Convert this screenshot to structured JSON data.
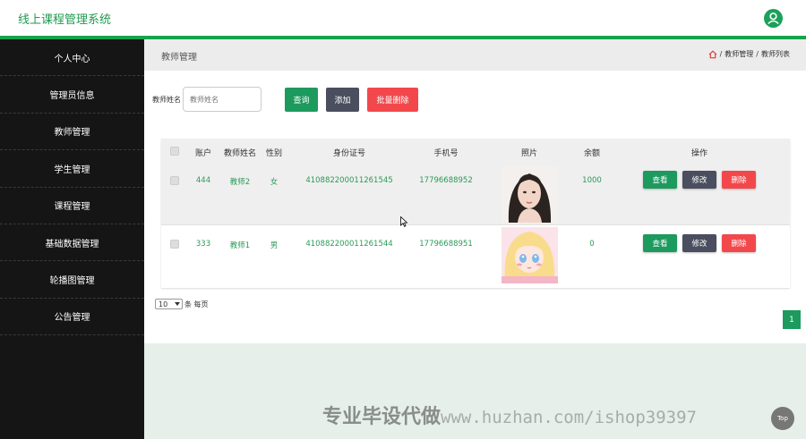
{
  "app": {
    "title": "线上课程管理系统"
  },
  "sidebar": {
    "items": [
      {
        "label": "个人中心"
      },
      {
        "label": "管理员信息"
      },
      {
        "label": "教师管理"
      },
      {
        "label": "学生管理"
      },
      {
        "label": "课程管理"
      },
      {
        "label": "基础数据管理"
      },
      {
        "label": "轮播图管理"
      },
      {
        "label": "公告管理"
      }
    ]
  },
  "header": {
    "page_title": "教师管理",
    "breadcrumb": [
      "教师管理",
      "教师列表"
    ],
    "home_icon": "home-icon"
  },
  "search": {
    "label": "教师姓名",
    "placeholder": "教师姓名",
    "query_label": "查询",
    "add_label": "添加",
    "batch_delete_label": "批量删除"
  },
  "table": {
    "columns": [
      "账户",
      "教师姓名",
      "性别",
      "身份证号",
      "手机号",
      "照片",
      "余额",
      "操作"
    ],
    "rows": [
      {
        "account": "444",
        "name": "教师2",
        "gender": "女",
        "id_card": "410882200011261545",
        "phone": "17796688952",
        "balance": "1000"
      },
      {
        "account": "333",
        "name": "教师1",
        "gender": "男",
        "id_card": "410882200011261544",
        "phone": "17796688951",
        "balance": "0"
      }
    ],
    "actions": {
      "view": "查看",
      "edit": "修改",
      "delete": "删除"
    }
  },
  "pager": {
    "page_size": "10",
    "per_page_label": "条 每页",
    "current_page": "1"
  },
  "watermark": {
    "text": "专业毕设代做",
    "url": "www.huzhan.com/ishop39397"
  },
  "back_to_top": {
    "label": "Top"
  },
  "colors": {
    "accent": "#1d9a5e",
    "danger": "#f2484c",
    "dark_button": "#4a4e5e",
    "sidebar": "#151515"
  }
}
